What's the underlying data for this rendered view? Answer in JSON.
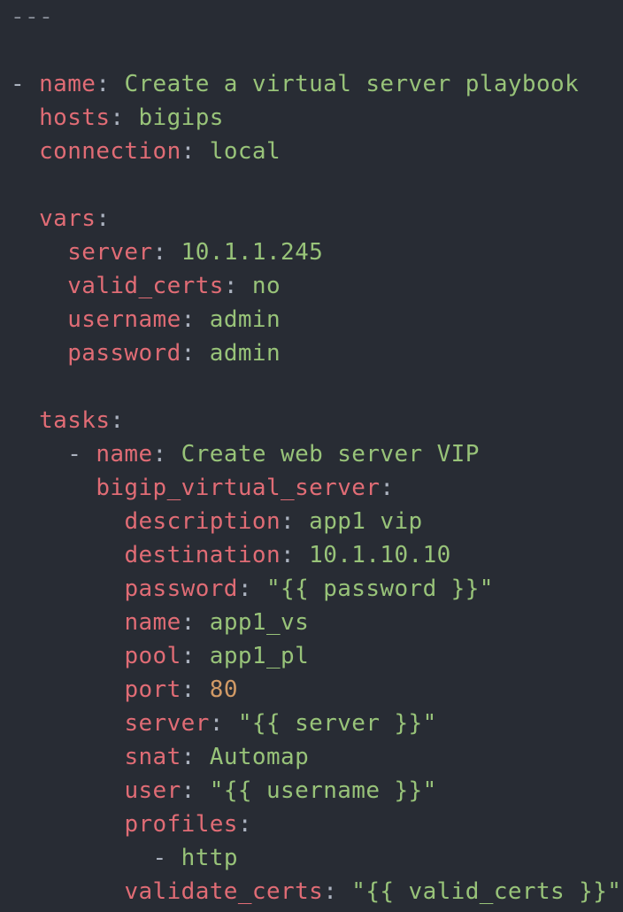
{
  "editor": {
    "lines": [
      {
        "indent": "",
        "doc": "---"
      },
      {
        "indent": ""
      },
      {
        "indent": "",
        "dash": "- ",
        "key": "name",
        "value": "Create a virtual server playbook",
        "vtype": "str"
      },
      {
        "indent": "  ",
        "key": "hosts",
        "value": "bigips",
        "vtype": "str"
      },
      {
        "indent": "  ",
        "key": "connection",
        "value": "local",
        "vtype": "str"
      },
      {
        "indent": ""
      },
      {
        "indent": "  ",
        "key": "vars",
        "value": "",
        "vtype": "str"
      },
      {
        "indent": "    ",
        "key": "server",
        "value": "10.1.1.245",
        "vtype": "str"
      },
      {
        "indent": "    ",
        "key": "valid_certs",
        "value": "no",
        "vtype": "str"
      },
      {
        "indent": "    ",
        "key": "username",
        "value": "admin",
        "vtype": "str"
      },
      {
        "indent": "    ",
        "key": "password",
        "value": "admin",
        "vtype": "str"
      },
      {
        "indent": ""
      },
      {
        "indent": "  ",
        "key": "tasks",
        "value": "",
        "vtype": "str"
      },
      {
        "indent": "    ",
        "dash": "- ",
        "key": "name",
        "value": "Create web server VIP",
        "vtype": "str"
      },
      {
        "indent": "      ",
        "key": "bigip_virtual_server",
        "value": "",
        "vtype": "str"
      },
      {
        "indent": "        ",
        "key": "description",
        "value": "app1 vip",
        "vtype": "str"
      },
      {
        "indent": "        ",
        "key": "destination",
        "value": "10.1.10.10",
        "vtype": "str"
      },
      {
        "indent": "        ",
        "key": "password",
        "value": "\"{{ password }}\"",
        "vtype": "str"
      },
      {
        "indent": "        ",
        "key": "name",
        "value": "app1_vs",
        "vtype": "str"
      },
      {
        "indent": "        ",
        "key": "pool",
        "value": "app1_pl",
        "vtype": "str"
      },
      {
        "indent": "        ",
        "key": "port",
        "value": "80",
        "vtype": "num"
      },
      {
        "indent": "        ",
        "key": "server",
        "value": "\"{{ server }}\"",
        "vtype": "str"
      },
      {
        "indent": "        ",
        "key": "snat",
        "value": "Automap",
        "vtype": "str"
      },
      {
        "indent": "        ",
        "key": "user",
        "value": "\"{{ username }}\"",
        "vtype": "str"
      },
      {
        "indent": "        ",
        "key": "profiles",
        "value": "",
        "vtype": "str"
      },
      {
        "indent": "          ",
        "dash": "- ",
        "item": "http"
      },
      {
        "indent": "        ",
        "key": "validate_certs",
        "value": "\"{{ valid_certs }}\"",
        "vtype": "str"
      }
    ]
  },
  "theme": {
    "background": "#282c34",
    "key_color": "#e06c75",
    "string_color": "#98c379",
    "number_color": "#d19a66",
    "punctuation_color": "#abb2bf"
  }
}
